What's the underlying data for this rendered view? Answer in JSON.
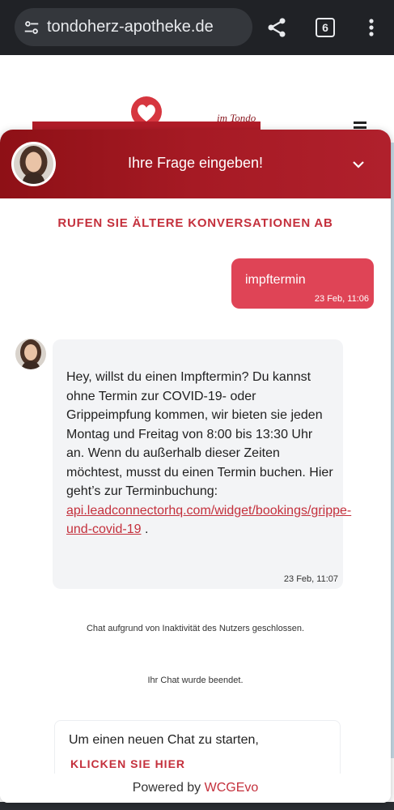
{
  "browser": {
    "url": "tondoherz-apotheke.de",
    "tab_count": "6",
    "icons": [
      "tune-icon",
      "share-icon",
      "tabs-icon",
      "more-vert-icon"
    ]
  },
  "website": {
    "logo_tagline": "im Tondo",
    "brand_color": "#b01c28"
  },
  "chat": {
    "header_title": "Ihre Frage eingeben!",
    "header_color": "#a61a24",
    "older_conversations": "RUFEN SIE ÄLTERE KONVERSATIONEN AB",
    "messages": [
      {
        "from": "user",
        "text": "impftermin",
        "time": "23 Feb, 11:06"
      },
      {
        "from": "agent",
        "text": "Hey, willst du einen Impftermin? Du kannst ohne Termin zur COVID-19- oder Grippeimpfung kommen, wir bieten sie jeden Montag und Freitag von 8:00 bis 13:30 Uhr an. Wenn du außerhalb dieser Zeiten möchtest, musst du einen Termin buchen. Hier geht’s zur Terminbuchung:",
        "link": "api.leadconnectorhq.com/widget/bookings/grippe-und-covid-19",
        "after_link": ".",
        "time": "23 Feb, 11:07"
      }
    ],
    "system_closed": "Chat aufgrund von Inaktivität des Nutzers geschlossen.",
    "system_ended": "Ihr Chat wurde beendet.",
    "restart_text": "Um einen neuen Chat zu starten,",
    "restart_button": "KLICKEN SIE HIER",
    "powered_by": "Powered by",
    "powered_brand": "WCGEvo",
    "accent_color": "#c4303c",
    "user_bubble_color": "#df4456"
  }
}
